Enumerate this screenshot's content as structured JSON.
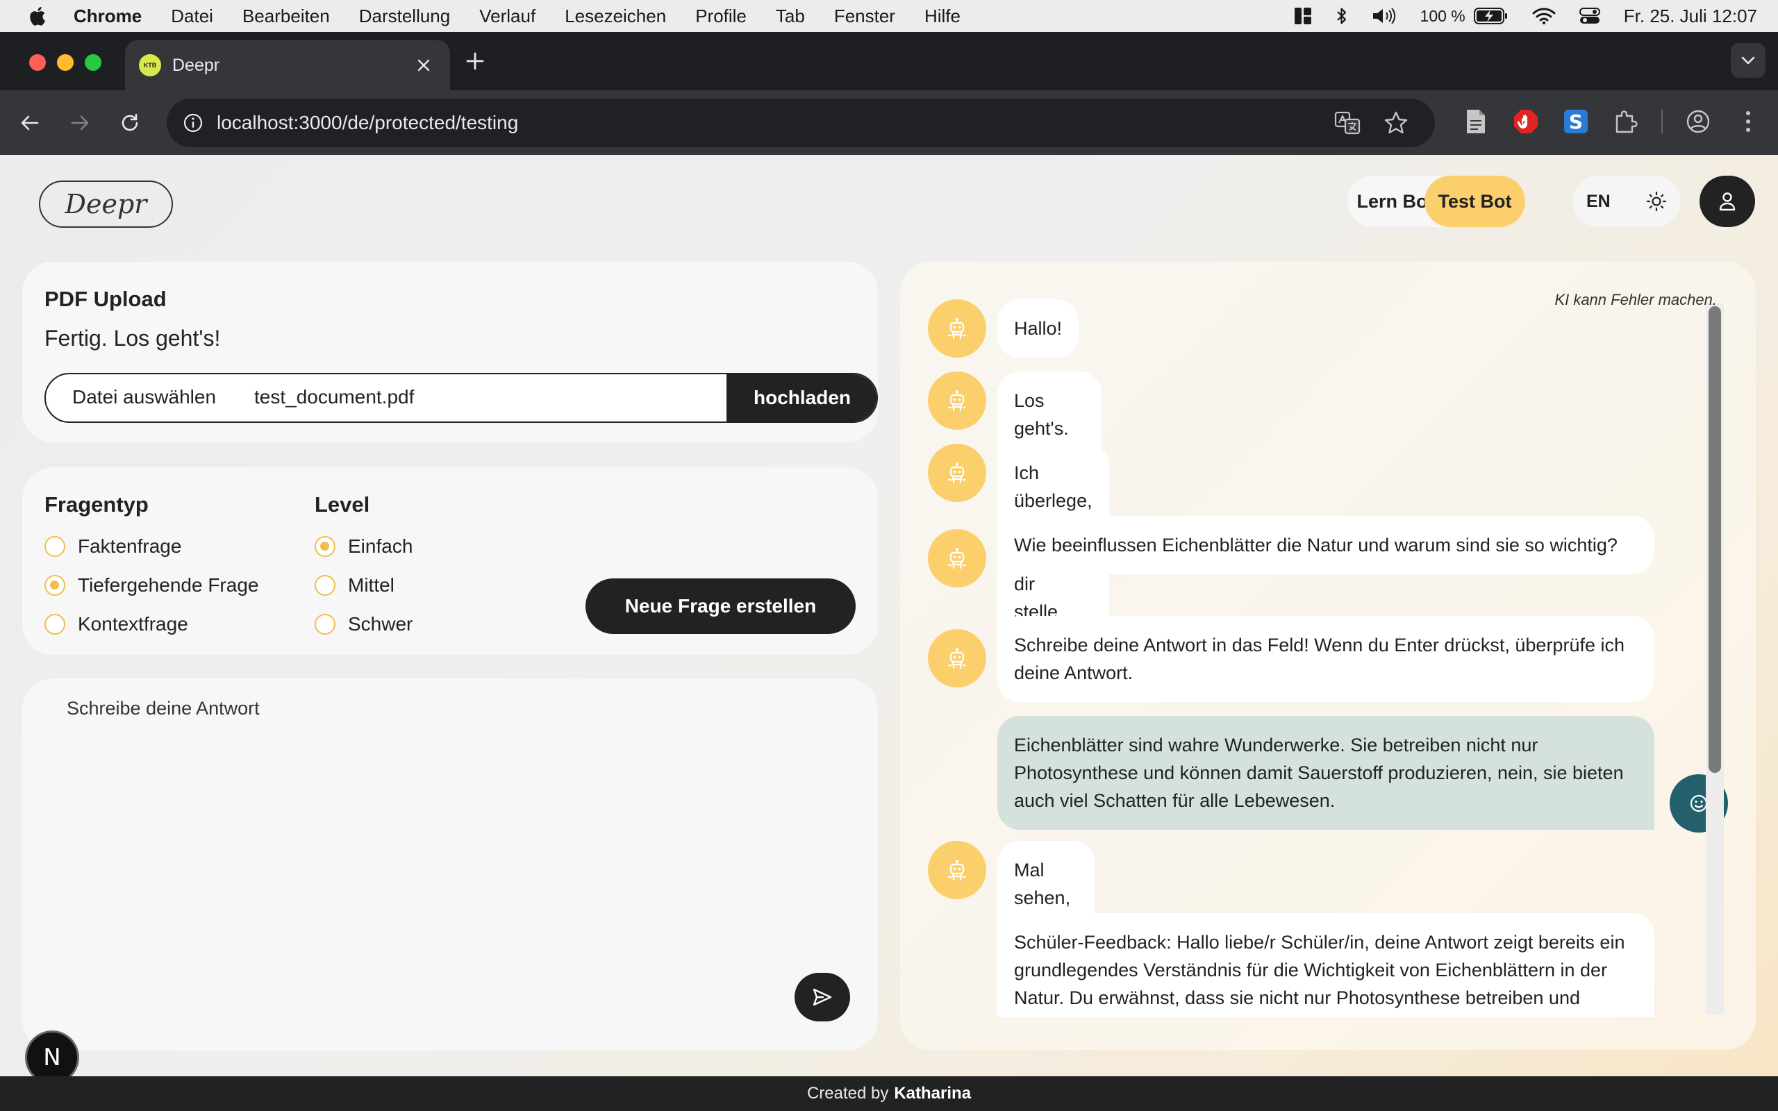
{
  "menubar": {
    "app_name": "Chrome",
    "items": [
      "Datei",
      "Bearbeiten",
      "Darstellung",
      "Verlauf",
      "Lesezeichen",
      "Profile",
      "Tab",
      "Fenster",
      "Hilfe"
    ],
    "battery": "100 %",
    "clock": "Fr. 25. Juli  12:07",
    "icons": [
      "apple-icon",
      "window-layout-icon",
      "bluetooth-icon",
      "volume-icon",
      "battery-charging-icon",
      "wifi-icon",
      "control-center-icon"
    ]
  },
  "browser": {
    "tab_title": "Deepr",
    "favicon_text": "KTB",
    "url": "localhost:3000/de/protected/testing"
  },
  "header": {
    "logo": "Deepr",
    "bot_modes": [
      "Lern Bot",
      "Test Bot"
    ],
    "active_mode": "Test Bot",
    "language": "EN"
  },
  "upload": {
    "title": "PDF Upload",
    "status": "Fertig. Los geht's!",
    "choose_label": "Datei auswählen",
    "filename": "test_document.pdf",
    "button": "hochladen"
  },
  "question_settings": {
    "type_heading": "Fragentyp",
    "types": [
      "Faktenfrage",
      "Tiefergehende Frage",
      "Kontextfrage"
    ],
    "selected_type": "Tiefergehende Frage",
    "level_heading": "Level",
    "levels": [
      "Einfach",
      "Mittel",
      "Schwer"
    ],
    "selected_level": "Einfach",
    "button": "Neue Frage erstellen"
  },
  "answer": {
    "placeholder": "Schreibe deine Antwort"
  },
  "chat": {
    "disclaimer": "KI kann Fehler machen.",
    "messages": [
      {
        "role": "bot",
        "text": "Hallo!"
      },
      {
        "role": "bot",
        "text": "Los geht's. Lade dein PDF hoch und starte die Abfrage!"
      },
      {
        "role": "bot",
        "text": "Ich überlege, welche Frage ich dir stelle..."
      },
      {
        "role": "bot",
        "text": "Wie beeinflussen Eichenblätter die Natur und warum sind sie so wichtig?"
      },
      {
        "role": "bot",
        "text": "Schreibe deine Antwort in das Feld! Wenn du Enter drückst, überprüfe ich deine Antwort."
      },
      {
        "role": "user",
        "text": "Eichenblätter sind wahre Wunderwerke. Sie betreiben nicht nur Photosynthese und können damit Sauerstoff produzieren, nein, sie bieten auch viel Schatten für alle Lebewesen."
      },
      {
        "role": "bot",
        "text": "Mal sehen, ob deine Antwort richtig ist..."
      },
      {
        "role": "bot",
        "text": "Schüler-Feedback: Hallo liebe/r Schüler/in, deine Antwort zeigt bereits ein grundlegendes Verständnis für die Wichtigkeit von Eichenblättern in der Natur. Du erwähnst, dass sie nicht nur Photosynthese betreiben und"
      }
    ]
  },
  "dev_badge": "N",
  "footer": {
    "prefix": "Created by",
    "author": "Katharina"
  }
}
